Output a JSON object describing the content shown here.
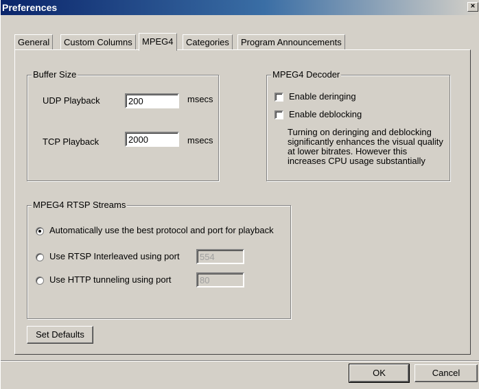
{
  "window": {
    "title": "Preferences",
    "close_glyph": "×"
  },
  "tabs": [
    {
      "label": "General"
    },
    {
      "label": "Custom Columns"
    },
    {
      "label": "MPEG4",
      "active": true
    },
    {
      "label": "Categories"
    },
    {
      "label": "Program Announcements"
    }
  ],
  "buffer": {
    "title": "Buffer Size",
    "udp_label": "UDP Playback",
    "udp_value": "200",
    "tcp_label": "TCP Playback",
    "tcp_value": "2000",
    "unit": "msecs"
  },
  "decoder": {
    "title": "MPEG4 Decoder",
    "deringing_label": "Enable deringing",
    "deringing_checked": false,
    "deblocking_label": "Enable deblocking",
    "deblocking_checked": false,
    "description": "Turning on deringing and deblocking significantly enhances the visual quality at lower bitrates. However this increases CPU usage substantially"
  },
  "rtsp": {
    "title": "MPEG4 RTSP Streams",
    "option_auto": "Automatically use the best protocol and port for playback",
    "option_interleaved": "Use RTSP Interleaved using port",
    "interleaved_port": "554",
    "option_http": "Use HTTP tunneling using port",
    "http_port": "80",
    "selected": "auto"
  },
  "buttons": {
    "set_defaults": "Set Defaults",
    "ok": "OK",
    "cancel": "Cancel"
  }
}
